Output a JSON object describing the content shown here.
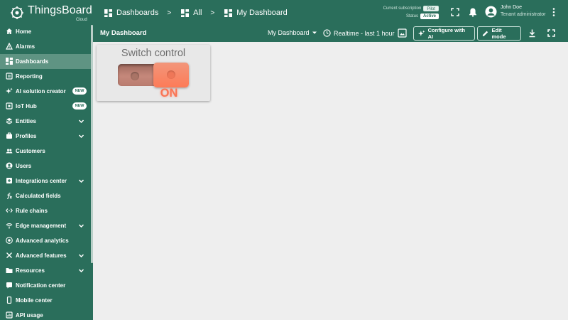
{
  "app": {
    "logo_name": "ThingsBoard",
    "logo_sub": "Cloud"
  },
  "breadcrumbs": [
    {
      "label": "Dashboards",
      "icon": "dashboard-grid-icon"
    },
    {
      "label": "All",
      "icon": "dashboard-grid-icon"
    },
    {
      "label": "My Dashboard",
      "icon": "dashboard-grid-icon"
    }
  ],
  "subscription": {
    "label": "Current subscription",
    "plan": "Pilot",
    "status_label": "Status",
    "status": "Active"
  },
  "user": {
    "name": "John Doe",
    "role": "Tenant administrator"
  },
  "sidebar": {
    "items": [
      {
        "label": "Home",
        "icon": "home-icon"
      },
      {
        "label": "Alarms",
        "icon": "alarm-icon"
      },
      {
        "label": "Dashboards",
        "icon": "dashboard-grid-icon",
        "active": true
      },
      {
        "label": "Reporting",
        "icon": "report-icon"
      },
      {
        "label": "AI solution creator",
        "icon": "sparkle-icon",
        "badge": "NEW"
      },
      {
        "label": "IoT Hub",
        "icon": "iot-hub-icon",
        "badge": "NEW"
      },
      {
        "label": "Entities",
        "icon": "entities-icon",
        "expandable": true
      },
      {
        "label": "Profiles",
        "icon": "profiles-icon",
        "expandable": true
      },
      {
        "label": "Customers",
        "icon": "customers-icon"
      },
      {
        "label": "Users",
        "icon": "user-icon"
      },
      {
        "label": "Integrations center",
        "icon": "integrations-icon",
        "expandable": true
      },
      {
        "label": "Calculated fields",
        "icon": "function-icon"
      },
      {
        "label": "Rule chains",
        "icon": "rule-chain-icon"
      },
      {
        "label": "Edge management",
        "icon": "edge-icon",
        "expandable": true
      },
      {
        "label": "Advanced analytics",
        "icon": "analytics-icon"
      },
      {
        "label": "Advanced features",
        "icon": "tools-icon",
        "expandable": true
      },
      {
        "label": "Resources",
        "icon": "folder-icon",
        "expandable": true
      },
      {
        "label": "Notification center",
        "icon": "notification-icon"
      },
      {
        "label": "Mobile center",
        "icon": "mobile-icon"
      },
      {
        "label": "API usage",
        "icon": "api-usage-icon"
      }
    ]
  },
  "dashboard": {
    "title": "My Dashboard",
    "selector": "My Dashboard",
    "timewindow": "Realtime - last 1 hour",
    "configure_ai": "Configure with AI",
    "edit_mode": "Edit mode"
  },
  "widget": {
    "title": "Switch control",
    "state": "ON",
    "is_on": true,
    "accent_color": "#fa7453"
  },
  "colors": {
    "primary": "#2a6e5b",
    "sidebar_active": "#5f9483",
    "background": "#eeeeee"
  }
}
